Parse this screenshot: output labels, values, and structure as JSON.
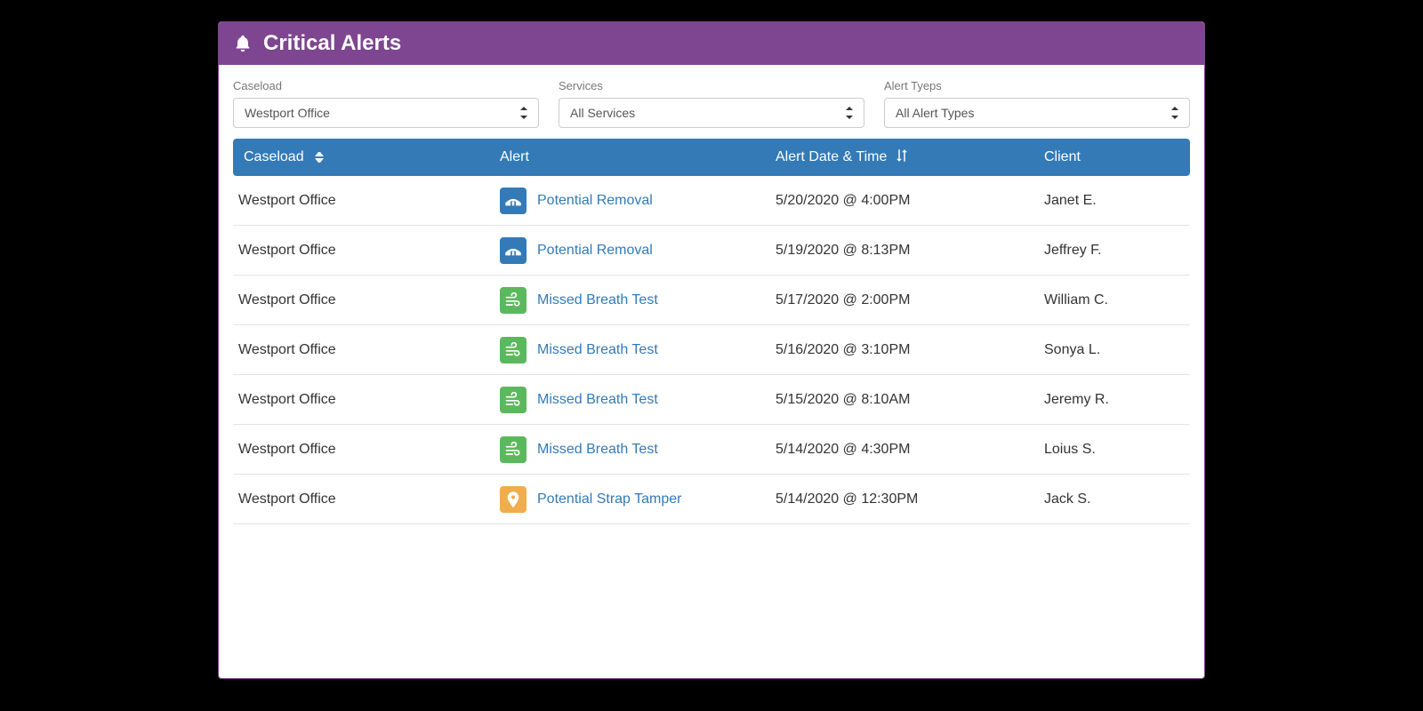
{
  "header": {
    "title": "Critical Alerts"
  },
  "filters": {
    "caseload": {
      "label": "Caseload",
      "value": "Westport Office"
    },
    "services": {
      "label": "Services",
      "value": "All Services"
    },
    "alert_types": {
      "label": "Alert Tyeps",
      "value": "All Alert Types"
    }
  },
  "table": {
    "columns": {
      "caseload": "Caseload",
      "alert": "Alert",
      "datetime": "Alert Date & Time",
      "client": "Client"
    },
    "rows": [
      {
        "caseload": "Westport Office",
        "icon": "removal",
        "alert": "Potential Removal",
        "datetime": "5/20/2020 @ 4:00PM",
        "client": "Janet E."
      },
      {
        "caseload": "Westport Office",
        "icon": "removal",
        "alert": "Potential Removal",
        "datetime": "5/19/2020 @ 8:13PM",
        "client": "Jeffrey F."
      },
      {
        "caseload": "Westport Office",
        "icon": "breath",
        "alert": "Missed Breath Test",
        "datetime": "5/17/2020 @ 2:00PM",
        "client": "William C."
      },
      {
        "caseload": "Westport Office",
        "icon": "breath",
        "alert": "Missed Breath Test",
        "datetime": "5/16/2020 @ 3:10PM",
        "client": "Sonya L."
      },
      {
        "caseload": "Westport Office",
        "icon": "breath",
        "alert": "Missed Breath Test",
        "datetime": "5/15/2020 @ 8:10AM",
        "client": "Jeremy R."
      },
      {
        "caseload": "Westport Office",
        "icon": "breath",
        "alert": "Missed Breath Test",
        "datetime": "5/14/2020 @ 4:30PM",
        "client": "Loius S."
      },
      {
        "caseload": "Westport Office",
        "icon": "tamper",
        "alert": "Potential Strap Tamper",
        "datetime": "5/14/2020 @ 12:30PM",
        "client": "Jack S."
      }
    ]
  },
  "icons": {
    "removal": {
      "color": "blue",
      "name": "bridge-icon"
    },
    "breath": {
      "color": "green",
      "name": "wind-icon"
    },
    "tamper": {
      "color": "orange",
      "name": "map-pin-icon"
    }
  }
}
